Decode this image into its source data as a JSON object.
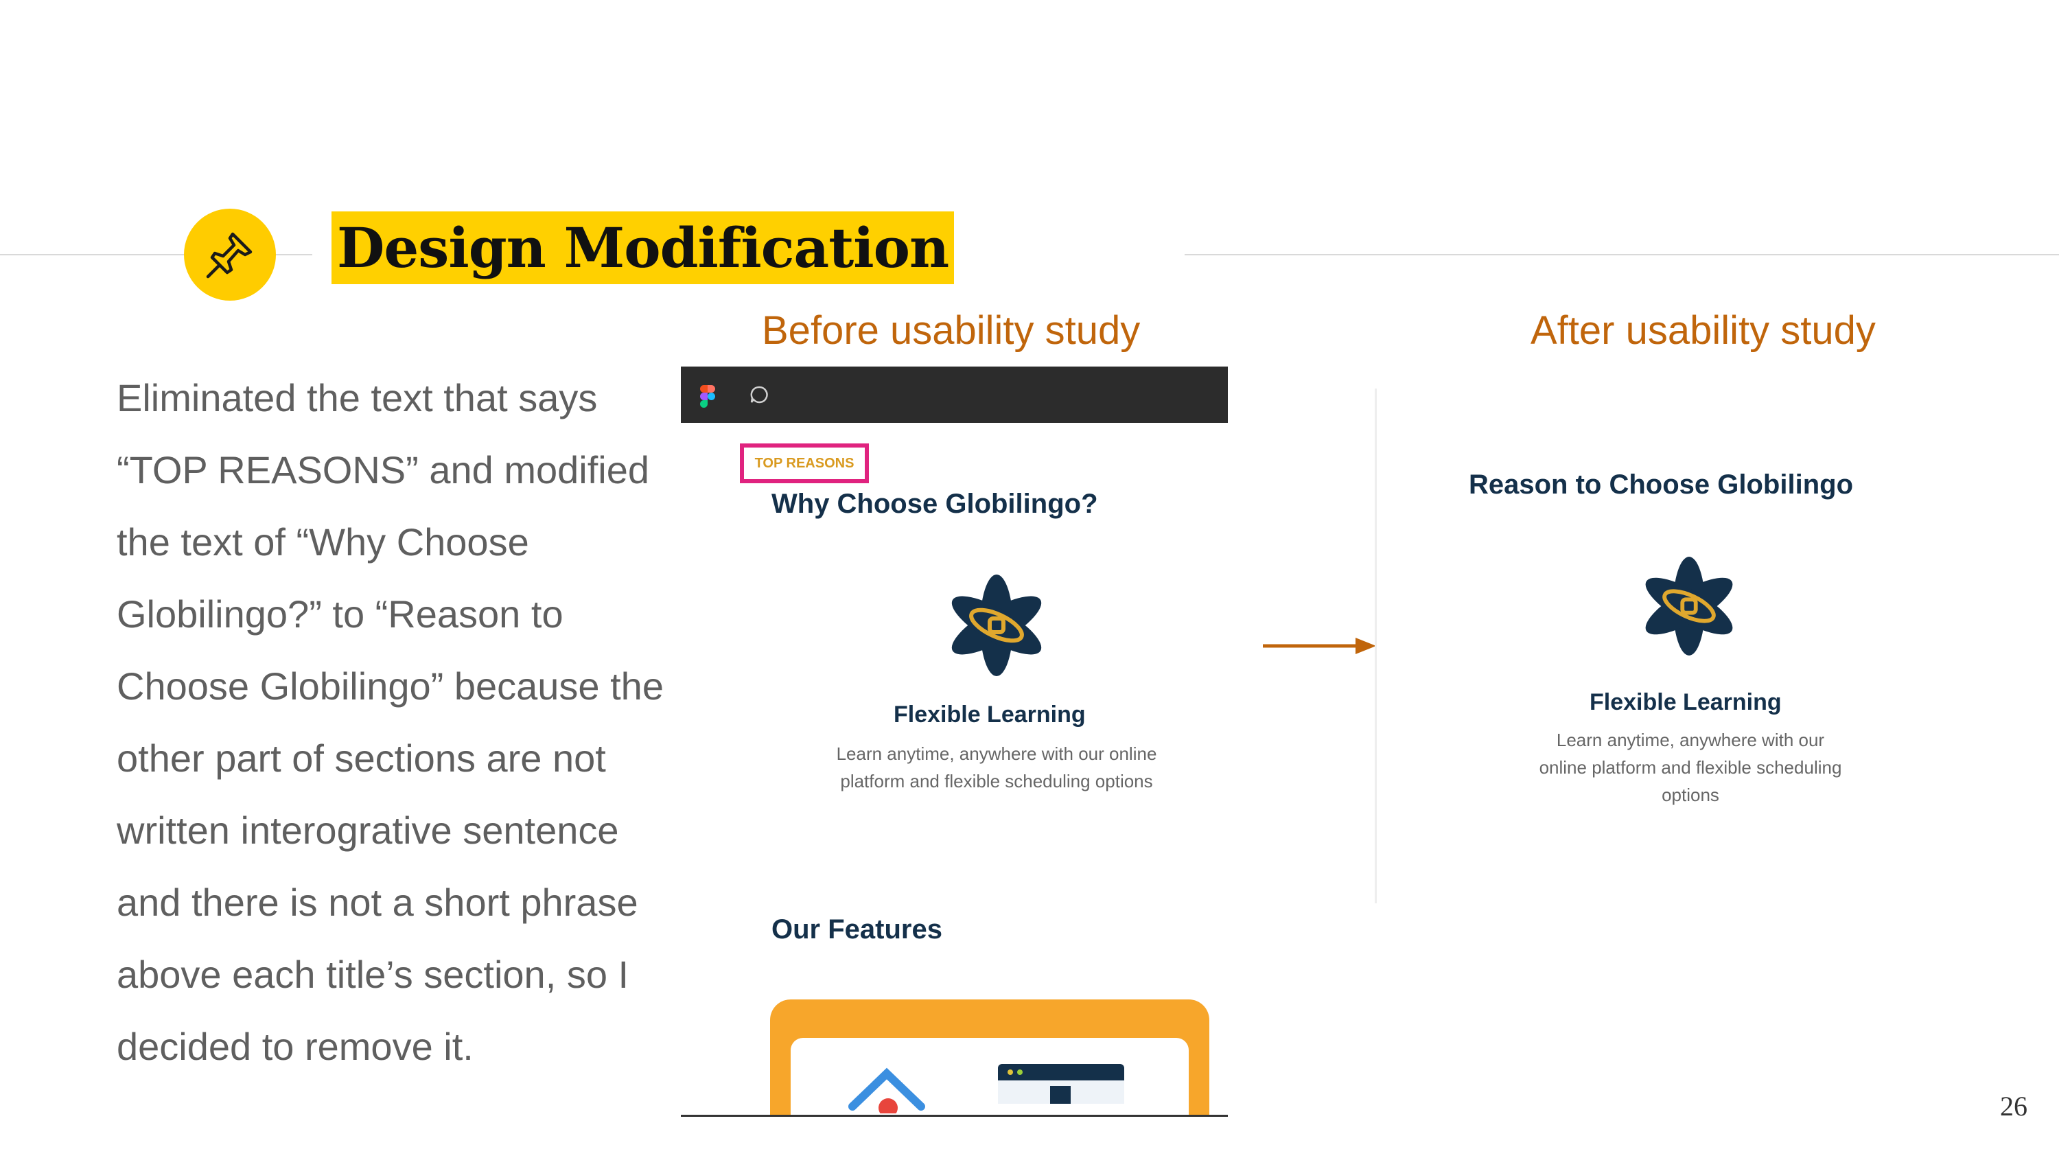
{
  "slide": {
    "title": "Design Modification",
    "body": "Eliminated the text that says “TOP REASONS” and modified the text of “Why Choose Globilingo?” to “Reason to Choose Globilingo” because the other part of sections are not written interogrative sentence and there is not a short phrase above each title’s section, so I decided to remove it.",
    "caption_before": "Before usability study",
    "caption_after": "After usability study",
    "page_number": "26",
    "icon": "pushpin-icon"
  },
  "before": {
    "tag": "TOP REASONS",
    "heading": "Why Choose Globilingo?",
    "feature_title": "Flexible Learning",
    "feature_desc": "Learn anytime, anywhere with our online platform and flexible scheduling options",
    "next_heading": "Our Features"
  },
  "after": {
    "heading": "Reason to Choose Globilingo",
    "feature_title": "Flexible Learning",
    "feature_desc": "Learn anytime, anywhere with our online platform and flexible scheduling options"
  },
  "colors": {
    "accent_yellow": "#ffd000",
    "caption_orange": "#c0650b",
    "highlight_pink": "#e0237f",
    "navy": "#14304a",
    "tag_gold": "#d99a1f",
    "card_orange": "#f7a62b"
  }
}
